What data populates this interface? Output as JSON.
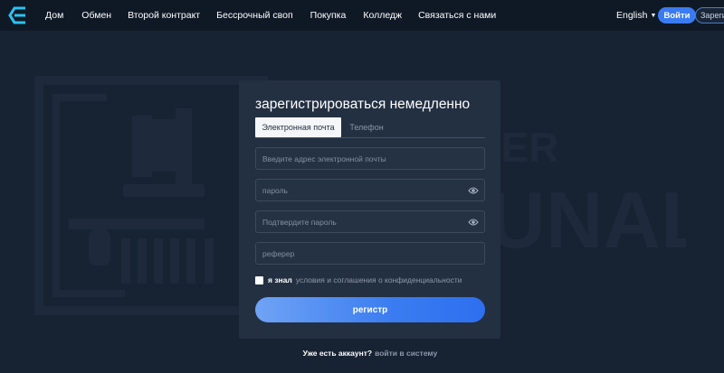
{
  "header": {
    "logo_icon": "exchange-logo-icon",
    "nav": [
      "Дом",
      "Обмен",
      "Второй контракт",
      "Бессрочный своп",
      "Покупка",
      "Колледж",
      "Связаться с нами"
    ],
    "language": "English",
    "login": "Войти",
    "register": "Зареги"
  },
  "watermark": {
    "line1": "BROKER",
    "line2": "TRIBUNAL"
  },
  "form": {
    "title": "зарегистрироваться немедленно",
    "tabs": [
      "Электронная почта",
      "Телефон"
    ],
    "active_tab": "Электронная почта",
    "email_placeholder": "Введите адрес электронной почты",
    "password_placeholder": "пароль",
    "confirm_placeholder": "Подтвердите пароль",
    "referrer_placeholder": "реферер",
    "agree_prefix": "я знал",
    "agree_link": "условия и соглашения о конфиденциальности",
    "submit": "регистр"
  },
  "footer": {
    "question": "Уже есть аккаунт?",
    "link": "войти в систему"
  },
  "colors": {
    "background": "#172232",
    "header": "#0f1926",
    "panel": "#233042",
    "accent": "#3b7bf2",
    "logo": "#29c4f0"
  }
}
